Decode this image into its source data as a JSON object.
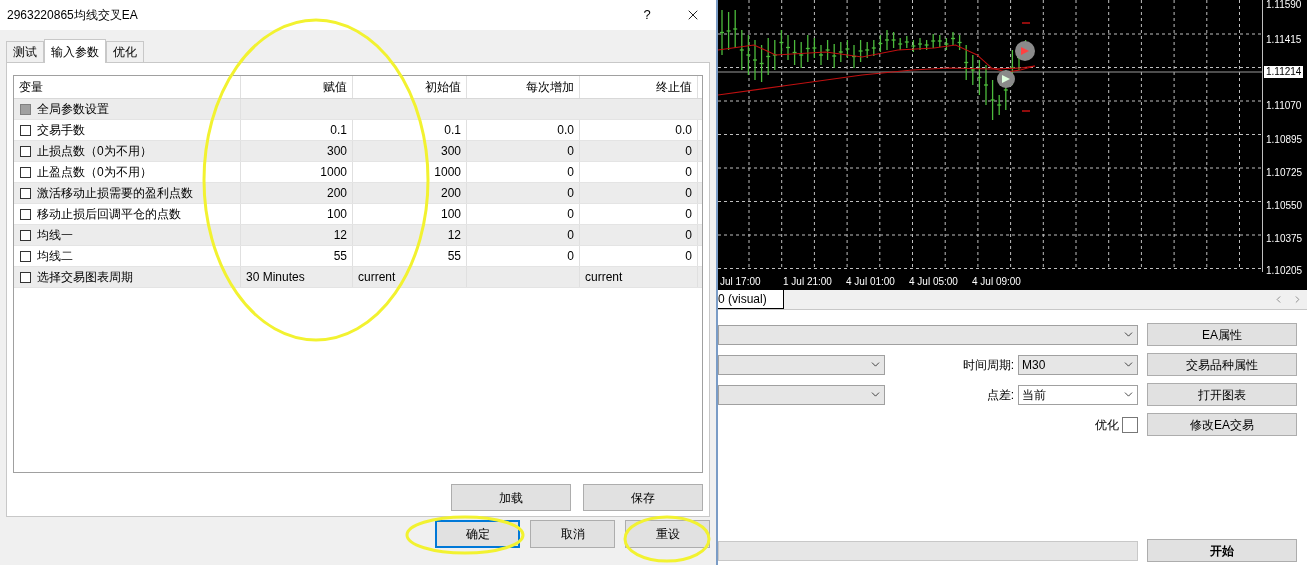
{
  "dialog": {
    "title": "2963220865均线交叉EA",
    "help": "?"
  },
  "tabs": [
    {
      "label": "测试",
      "selected": false
    },
    {
      "label": "输入参数",
      "selected": true
    },
    {
      "label": "优化",
      "selected": false
    }
  ],
  "table": {
    "columns": [
      "变量",
      "赋值",
      "初始值",
      "每次增加",
      "终止值"
    ],
    "rows": [
      {
        "kind": "group",
        "checked": false,
        "name": "全局参数设置"
      },
      {
        "kind": "param",
        "checked": false,
        "name": "交易手数",
        "value": "0.1",
        "start": "0.1",
        "step": "0.0",
        "stop": "0.0"
      },
      {
        "kind": "param",
        "checked": false,
        "name": "止损点数（0为不用）",
        "value": "300",
        "start": "300",
        "step": "0",
        "stop": "0"
      },
      {
        "kind": "param",
        "checked": false,
        "name": "止盈点数（0为不用）",
        "value": "1000",
        "start": "1000",
        "step": "0",
        "stop": "0"
      },
      {
        "kind": "param",
        "checked": false,
        "name": "激活移动止损需要的盈利点数",
        "value": "200",
        "start": "200",
        "step": "0",
        "stop": "0"
      },
      {
        "kind": "param",
        "checked": false,
        "name": "移动止损后回调平仓的点数",
        "value": "100",
        "start": "100",
        "step": "0",
        "stop": "0"
      },
      {
        "kind": "param",
        "checked": false,
        "name": "均线一",
        "value": "12",
        "start": "12",
        "step": "0",
        "stop": "0"
      },
      {
        "kind": "param",
        "checked": false,
        "name": "均线二",
        "value": "55",
        "start": "55",
        "step": "0",
        "stop": "0"
      },
      {
        "kind": "param",
        "checked": false,
        "name": "选择交易图表周期",
        "value": "30 Minutes",
        "start": "current",
        "stop": "current"
      }
    ]
  },
  "table_buttons": [
    "加载",
    "保存"
  ],
  "dialog_buttons": [
    {
      "label": "确定",
      "focused": true
    },
    {
      "label": "取消",
      "focused": false
    },
    {
      "label": "重设",
      "focused": false
    }
  ],
  "chart": {
    "price_labels": [
      "1.11590",
      "1.11415",
      "1.11070",
      "1.10895",
      "1.10725",
      "1.10550",
      "1.10375",
      "1.10205"
    ],
    "current_price": "1.11214",
    "time_labels": [
      "Jul 17:00",
      "1 Jul 21:00",
      "4 Jul 01:00",
      "4 Jul 05:00",
      "4 Jul 09:00"
    ]
  },
  "bottom_tabs": [
    {
      "label": "0 (visual)",
      "selected": true
    }
  ],
  "side_buttons": [
    "EA属性",
    "交易品种属性",
    "打开图表",
    "修改EA交易"
  ],
  "period": {
    "label": "时间周期:",
    "value": "M30"
  },
  "spread": {
    "label": "点差:",
    "value": "当前"
  },
  "optimize": {
    "label": "优化",
    "checked": false
  },
  "progress": {
    "level": 0
  },
  "start_button": "开始"
}
